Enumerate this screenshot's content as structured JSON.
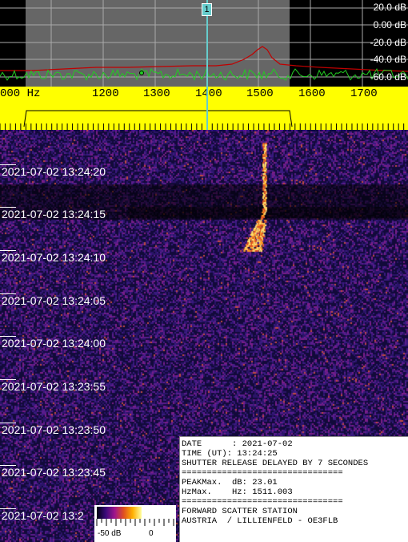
{
  "spectrum": {
    "db_labels": [
      "20.0 dB",
      "0.00 dB",
      "-20.0 dB",
      "-40.0 dB",
      "-60.0 dB"
    ],
    "marker_label": "1"
  },
  "frequency_axis": {
    "labels": [
      "000 Hz",
      "1200",
      "1300",
      "1400",
      "1500",
      "1600",
      "1700"
    ]
  },
  "waterfall": {
    "timestamps": [
      "2021-07-02 13:24:20",
      "2021-07-02 13:24:15",
      "2021-07-02 13:24:10",
      "2021-07-02 13:24:05",
      "2021-07-02 13:24:00",
      "2021-07-02 13:23:55",
      "2021-07-02 13:23:50",
      "2021-07-02 13:23:45",
      "2021-07-02 13:2"
    ]
  },
  "info_panel": {
    "date_row": "DATE      : 2021-07-02",
    "time_row": "TIME (UT): 13:24:25",
    "shutter_row": "SHUTTER RELEASE DELAYED BY 7 SECONDES",
    "separator": "================================",
    "peak_db_row": "PEAKMax.  dB: 23.01",
    "peak_hz_row": "HzMax.    Hz: 1511.003",
    "station_row": "FORWARD SCATTER STATION",
    "location_row": "AUSTRIA  / LILLIENFELD - OE3FLB"
  },
  "color_scale": {
    "min_label": "-50 dB",
    "max_label": "0"
  }
}
